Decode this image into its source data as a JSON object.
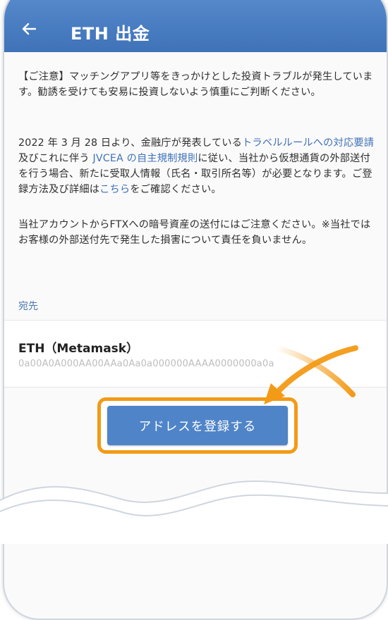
{
  "header": {
    "title": "ETH 出金"
  },
  "notices": {
    "caution": "【ご注意】マッチングアプリ等をきっかけとした投資トラブルが発生しています。勧誘を受けても安易に投資しないよう慎重にご判断ください。",
    "travel_rule": {
      "part1": "2022 年 3 月 28 日より、金融庁が発表している",
      "link1": "トラベルルールへの対応要請",
      "part2": "及びこれに伴う ",
      "link2": "JVCEA の自主規制規則",
      "part3": "に従い、当社から仮想通貨の外部送付を行う場合、新たに受取人情報（氏名・取引所名等）が必要となります。ご登録方法及び詳細は",
      "link3": "こちら",
      "part4": "をご確認ください。"
    },
    "ftx": "当社アカウントからFTXへの暗号資産の送付にはご注意ください。※当社ではお客様の外部送付先で発生した損害について責任を負いません。"
  },
  "destination": {
    "section_label": "宛先",
    "name": "ETH（Metamask）",
    "address": "0a00A0A000AA00AAa0Aa0a000000AAAA0000000a0a"
  },
  "actions": {
    "register_label": "アドレスを登録する"
  },
  "colors": {
    "header": "#4a80c4",
    "link": "#3f72b8",
    "button": "#4f84c8",
    "highlight": "#f39a16"
  },
  "icons": {
    "back": "arrow-left-icon",
    "pointer": "curved-arrow-icon"
  }
}
